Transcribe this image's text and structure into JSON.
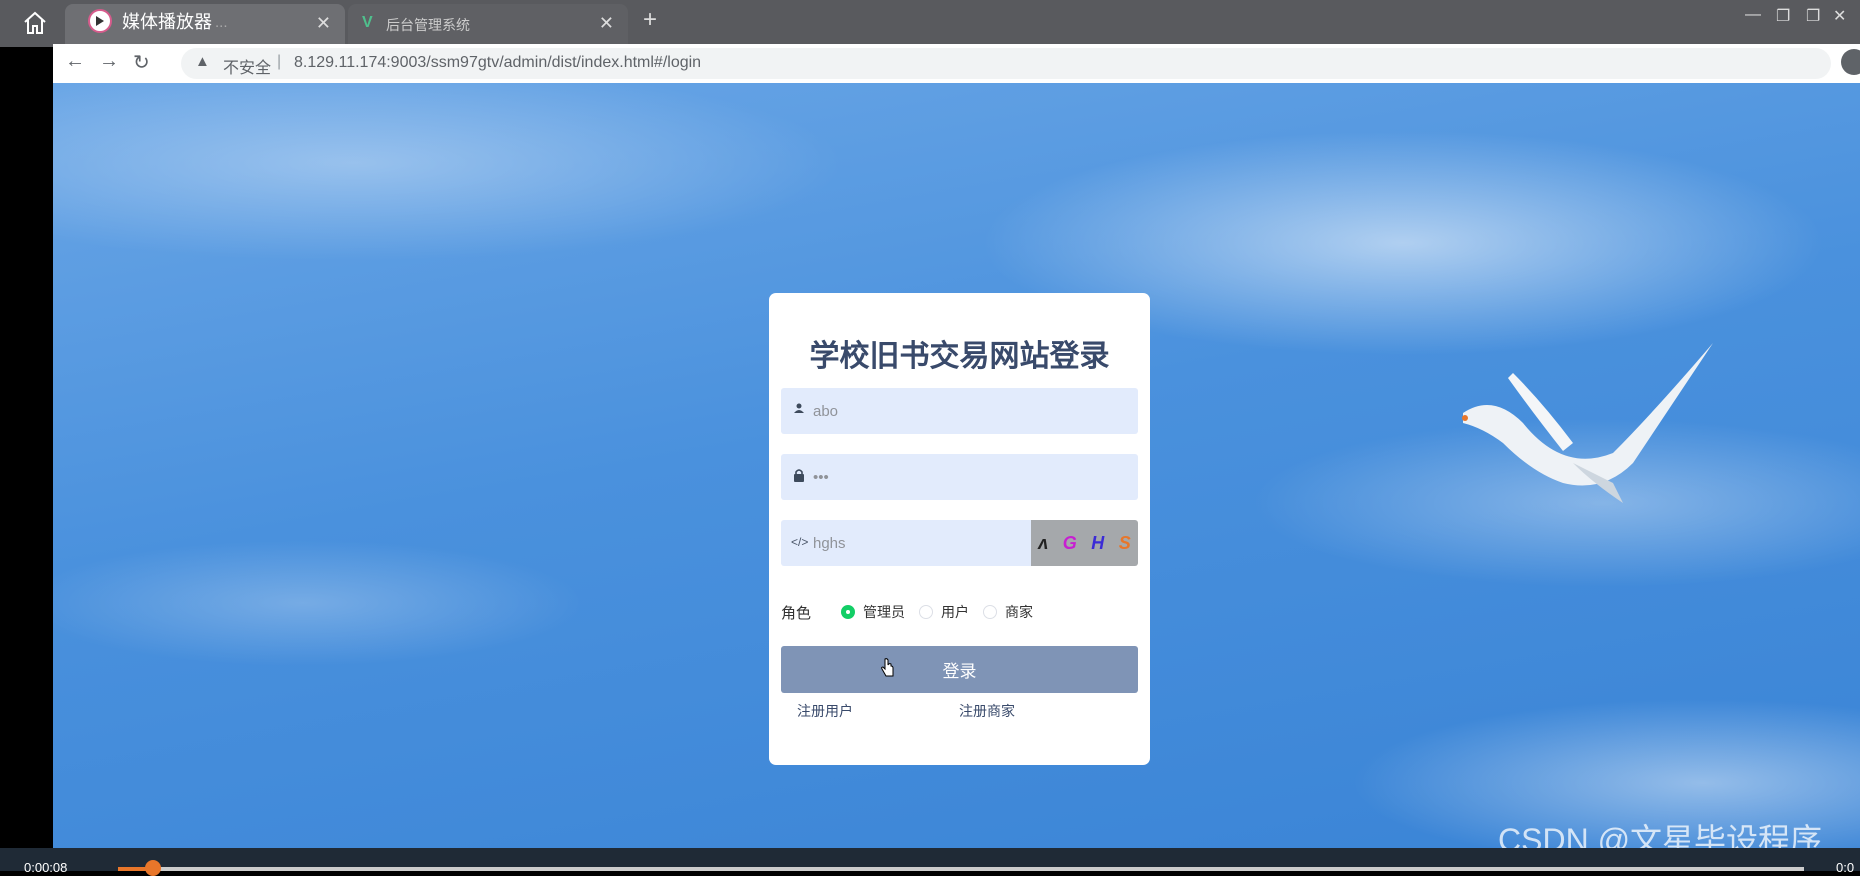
{
  "player": {
    "title": "媒体播放器",
    "time_current": "0:00:08",
    "time_total": "0:0",
    "progress": 0.017,
    "accent_color": "#e8762a"
  },
  "browser": {
    "tabs": [
      {
        "label": "后台管理系统",
        "icon": "vue-logo-icon"
      }
    ],
    "nav": {
      "back_icon": "arrow-left-icon",
      "forward_icon": "arrow-right-icon",
      "reload_icon": "reload-icon"
    },
    "url": {
      "warning_icon": "warning-triangle-icon",
      "security_label": "不安全",
      "separator": "|",
      "address": "8.129.11.174:9003/ssm97gtv/admin/dist/index.html#/login"
    }
  },
  "login": {
    "title": "学校旧书交易网站登录",
    "username_value": "abo",
    "password_value": "•••",
    "captcha_input_value": "hghs",
    "captcha_chars": [
      {
        "char": "ʌ",
        "color": "#222222"
      },
      {
        "char": "G",
        "color": "#c71fd1"
      },
      {
        "char": "H",
        "color": "#3b2bd6"
      },
      {
        "char": "S",
        "color": "#e8762a"
      }
    ],
    "role_label": "角色",
    "roles": [
      {
        "label": "管理员",
        "selected": true
      },
      {
        "label": "用户",
        "selected": false
      },
      {
        "label": "商家",
        "selected": false
      }
    ],
    "submit_label": "登录",
    "register_user_label": "注册用户",
    "register_merchant_label": "注册商家",
    "button_color": "#7f94b6",
    "radio_selected_color": "#13ce66"
  },
  "watermark": "CSDN @文星毕设程序"
}
